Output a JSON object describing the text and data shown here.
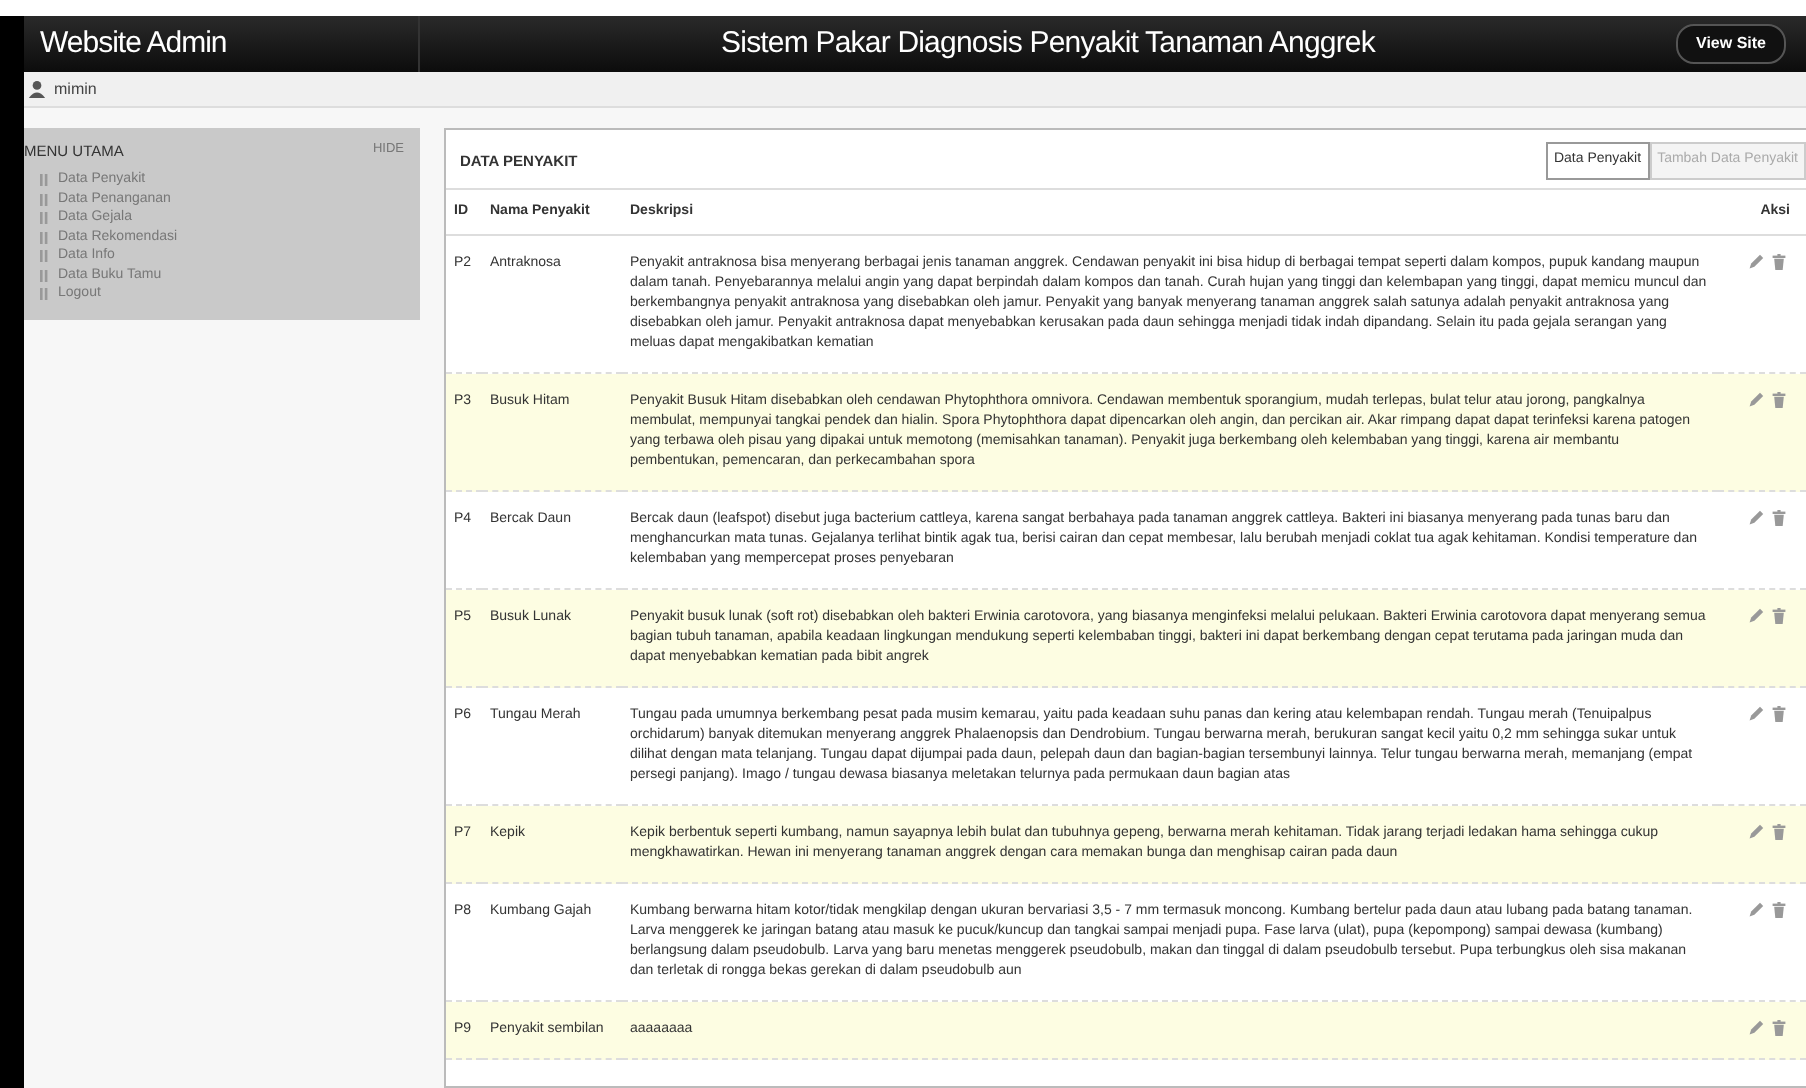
{
  "header": {
    "brand": "Website Admin",
    "title": "Sistem Pakar Diagnosis Penyakit Tanaman Anggrek",
    "view_site": "View Site"
  },
  "user": {
    "name": "mimin"
  },
  "sidebar": {
    "heading": "MENU UTAMA",
    "hide": "HIDE",
    "items": [
      {
        "label": "Data Penyakit"
      },
      {
        "label": "Data Penanganan"
      },
      {
        "label": "Data Gejala"
      },
      {
        "label": "Data Rekomendasi"
      },
      {
        "label": "Data Info"
      },
      {
        "label": "Data Buku Tamu"
      },
      {
        "label": "Logout"
      }
    ]
  },
  "panel": {
    "title": "DATA PENYAKIT",
    "tabs": [
      {
        "label": "Data Penyakit",
        "selected": true
      },
      {
        "label": "Tambah Data Penyakit",
        "selected": false
      }
    ]
  },
  "table": {
    "columns": [
      "ID",
      "Nama Penyakit",
      "Deskripsi",
      "Aksi"
    ],
    "rows": [
      {
        "id": "P2",
        "name": "Antraknosa",
        "description": "Penyakit antraknosa bisa menyerang berbagai jenis tanaman anggrek. Cendawan penyakit ini bisa hidup di berbagai tempat seperti dalam kompos, pupuk kandang maupun dalam tanah. Penyebarannya melalui angin yang dapat berpindah dalam kompos dan tanah. Curah hujan yang tinggi dan kelembapan yang tinggi, dapat memicu muncul dan berkembangnya penyakit antraknosa yang disebabkan oleh jamur. Penyakit yang banyak menyerang tanaman anggrek salah satunya adalah penyakit antraknosa yang disebabkan oleh jamur. Penyakit antraknosa dapat menyebabkan kerusakan pada daun sehingga menjadi tidak indah dipandang. Selain itu pada gejala serangan yang meluas dapat mengakibatkan kematian"
      },
      {
        "id": "P3",
        "name": "Busuk Hitam",
        "description": "Penyakit Busuk Hitam disebabkan oleh cendawan Phytophthora omnivora. Cendawan membentuk sporangium, mudah terlepas, bulat telur atau jorong, pangkalnya membulat, mempunyai tangkai pendek dan hialin. Spora Phytophthora dapat dipencarkan oleh angin, dan percikan air. Akar rimpang dapat dapat terinfeksi karena patogen yang terbawa oleh pisau yang dipakai untuk memotong (memisahkan tanaman). Penyakit juga berkembang oleh kelembaban yang tinggi, karena air membantu pembentukan, pemencaran, dan perkecambahan spora"
      },
      {
        "id": "P4",
        "name": "Bercak Daun",
        "description": "Bercak daun (leafspot) disebut juga bacterium cattleya, karena sangat berbahaya pada tanaman anggrek cattleya. Bakteri ini biasanya menyerang pada tunas baru dan menghancurkan mata tunas. Gejalanya terlihat bintik agak tua, berisi cairan dan cepat membesar, lalu berubah menjadi coklat tua agak kehitaman. Kondisi temperature dan kelembaban yang mempercepat proses penyebaran"
      },
      {
        "id": "P5",
        "name": "Busuk Lunak",
        "description": "Penyakit busuk lunak (soft rot) disebabkan oleh bakteri Erwinia carotovora, yang biasanya menginfeksi melalui pelukaan. Bakteri Erwinia carotovora dapat menyerang semua bagian tubuh tanaman, apabila keadaan lingkungan mendukung seperti kelembaban tinggi, bakteri ini dapat berkembang dengan cepat terutama pada jaringan muda dan dapat menyebabkan kematian pada bibit angrek"
      },
      {
        "id": "P6",
        "name": "Tungau Merah",
        "description": "Tungau pada umumnya berkembang pesat pada musim kemarau, yaitu pada keadaan suhu panas dan kering atau kelembapan rendah. Tungau merah (Tenuipalpus orchidarum) banyak ditemukan menyerang anggrek Phalaenopsis dan Dendrobium. Tungau berwarna merah, berukuran sangat kecil yaitu 0,2 mm sehingga sukar untuk dilihat dengan mata telanjang. Tungau dapat dijumpai pada daun, pelepah daun dan bagian-bagian tersembunyi lainnya. Telur tungau berwarna merah, memanjang (empat persegi panjang). Imago / tungau dewasa biasanya meletakan telurnya pada permukaan daun bagian atas"
      },
      {
        "id": "P7",
        "name": "Kepik",
        "description": "Kepik berbentuk seperti kumbang, namun sayapnya lebih bulat dan tubuhnya gepeng, berwarna merah kehitaman. Tidak jarang terjadi ledakan hama sehingga cukup mengkhawatirkan. Hewan ini menyerang tanaman anggrek dengan cara memakan bunga dan menghisap cairan pada daun"
      },
      {
        "id": "P8",
        "name": "Kumbang Gajah",
        "description": "Kumbang berwarna hitam kotor/tidak mengkilap dengan ukuran bervariasi 3,5 - 7 mm termasuk moncong. Kumbang bertelur pada daun atau lubang pada batang tanaman. Larva menggerek ke jaringan batang atau masuk ke pucuk/kuncup dan tangkai sampai menjadi pupa. Fase larva (ulat), pupa (kepompong) sampai dewasa (kumbang) berlangsung dalam pseudobulb. Larva yang baru menetas menggerek pseudobulb, makan dan tinggal di dalam pseudobulb tersebut. Pupa terbungkus oleh sisa makanan dan terletak di rongga bekas gerekan di dalam pseudobulb aun"
      },
      {
        "id": "P9",
        "name": "Penyakit sembilan",
        "description": "aaaaaaaa"
      }
    ]
  }
}
